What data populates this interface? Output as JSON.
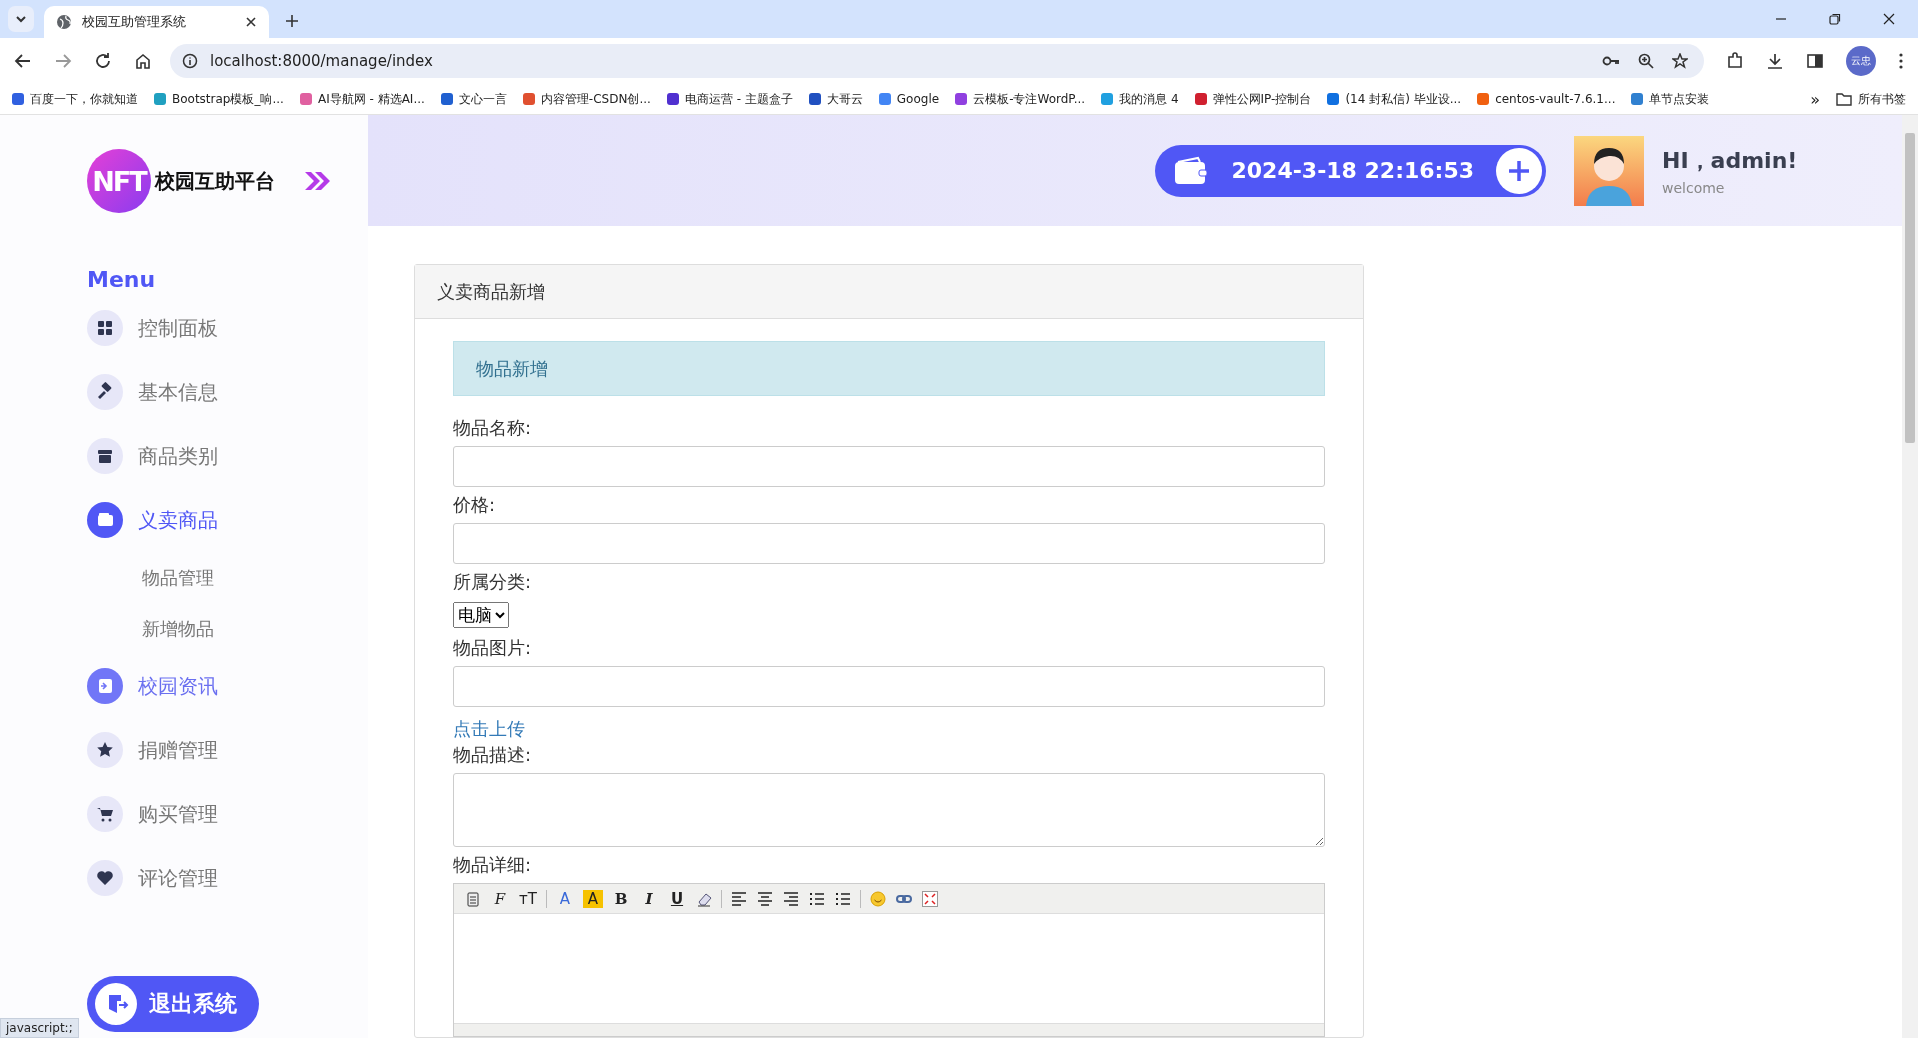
{
  "browser": {
    "tabs": [
      {
        "title": "校园互助管理系统",
        "selected": true
      }
    ],
    "url": "localhost:8000/manage/index",
    "profile": "云忠",
    "bookmarks": [
      {
        "label": "百度一下，你就知道",
        "color": "#3060e0"
      },
      {
        "label": "Bootstrap模板_响...",
        "color": "#20a0c0"
      },
      {
        "label": "AI导航网 - 精选AI...",
        "color": "#e060a0"
      },
      {
        "label": "文心一言",
        "color": "#2060d0"
      },
      {
        "label": "内容管理-CSDN创...",
        "color": "#e05030"
      },
      {
        "label": "电商运营 - 主题盒子",
        "color": "#5030d0"
      },
      {
        "label": "大哥云",
        "color": "#2050c0"
      },
      {
        "label": "Google",
        "color": "#4285f4"
      },
      {
        "label": "云模板-专注WordP...",
        "color": "#9040e0"
      },
      {
        "label": "我的消息 4",
        "color": "#20a0e0"
      },
      {
        "label": "弹性公网IP-控制台",
        "color": "#d02030"
      },
      {
        "label": "(14 封私信) 毕业设...",
        "color": "#1070e0"
      },
      {
        "label": "centos-vault-7.6.1...",
        "color": "#f06010"
      },
      {
        "label": "单节点安装",
        "color": "#3080d0"
      }
    ],
    "overflow": "»",
    "all_bookmarks": "所有书签",
    "status": "javascript:;"
  },
  "sidebar": {
    "logo_mark": "NFT",
    "logo_text": "校园互助平台",
    "menu_title": "Menu",
    "items": [
      {
        "label": "控制面板",
        "selected": false,
        "hover": false
      },
      {
        "label": "基本信息",
        "selected": false,
        "hover": false
      },
      {
        "label": "商品类别",
        "selected": false,
        "hover": false
      },
      {
        "label": "义卖商品",
        "selected": true,
        "hover": false,
        "children": [
          {
            "label": "物品管理"
          },
          {
            "label": "新增物品"
          }
        ]
      },
      {
        "label": "校园资讯",
        "selected": false,
        "hover": true
      },
      {
        "label": "捐赠管理",
        "selected": false,
        "hover": false
      },
      {
        "label": "购买管理",
        "selected": false,
        "hover": false
      },
      {
        "label": "评论管理",
        "selected": false,
        "hover": false
      }
    ],
    "logout": "退出系统"
  },
  "header": {
    "datetime": "2024-3-18 22:16:53",
    "greeting": "HI，admin!",
    "subtitle": "welcome"
  },
  "panel": {
    "title": "义卖商品新增",
    "alert": "物品新增",
    "fields": [
      {
        "kind": "text",
        "label": "物品名称:"
      },
      {
        "kind": "text",
        "label": "价格:"
      },
      {
        "kind": "select",
        "label": "所属分类:",
        "value": "电脑"
      },
      {
        "kind": "text",
        "label": "物品图片:",
        "link": "点击上传"
      },
      {
        "kind": "textarea",
        "label": "物品描述:"
      },
      {
        "kind": "editor",
        "label": "物品详细:"
      }
    ],
    "toolbar": [
      {
        "kind": "paste"
      },
      {
        "kind": "font",
        "text": "F"
      },
      {
        "kind": "size",
        "text": "тT"
      },
      {
        "kind": "sep"
      },
      {
        "kind": "color",
        "text": "A"
      },
      {
        "kind": "bg",
        "text": "A"
      },
      {
        "kind": "bold",
        "text": "B"
      },
      {
        "kind": "italic",
        "text": "I"
      },
      {
        "kind": "underline",
        "text": "U"
      },
      {
        "kind": "eraser"
      },
      {
        "kind": "sep"
      },
      {
        "kind": "left"
      },
      {
        "kind": "center"
      },
      {
        "kind": "right"
      },
      {
        "kind": "ol"
      },
      {
        "kind": "ul"
      },
      {
        "kind": "sep"
      },
      {
        "kind": "emoji"
      },
      {
        "kind": "link"
      },
      {
        "kind": "fullscreen"
      }
    ]
  }
}
